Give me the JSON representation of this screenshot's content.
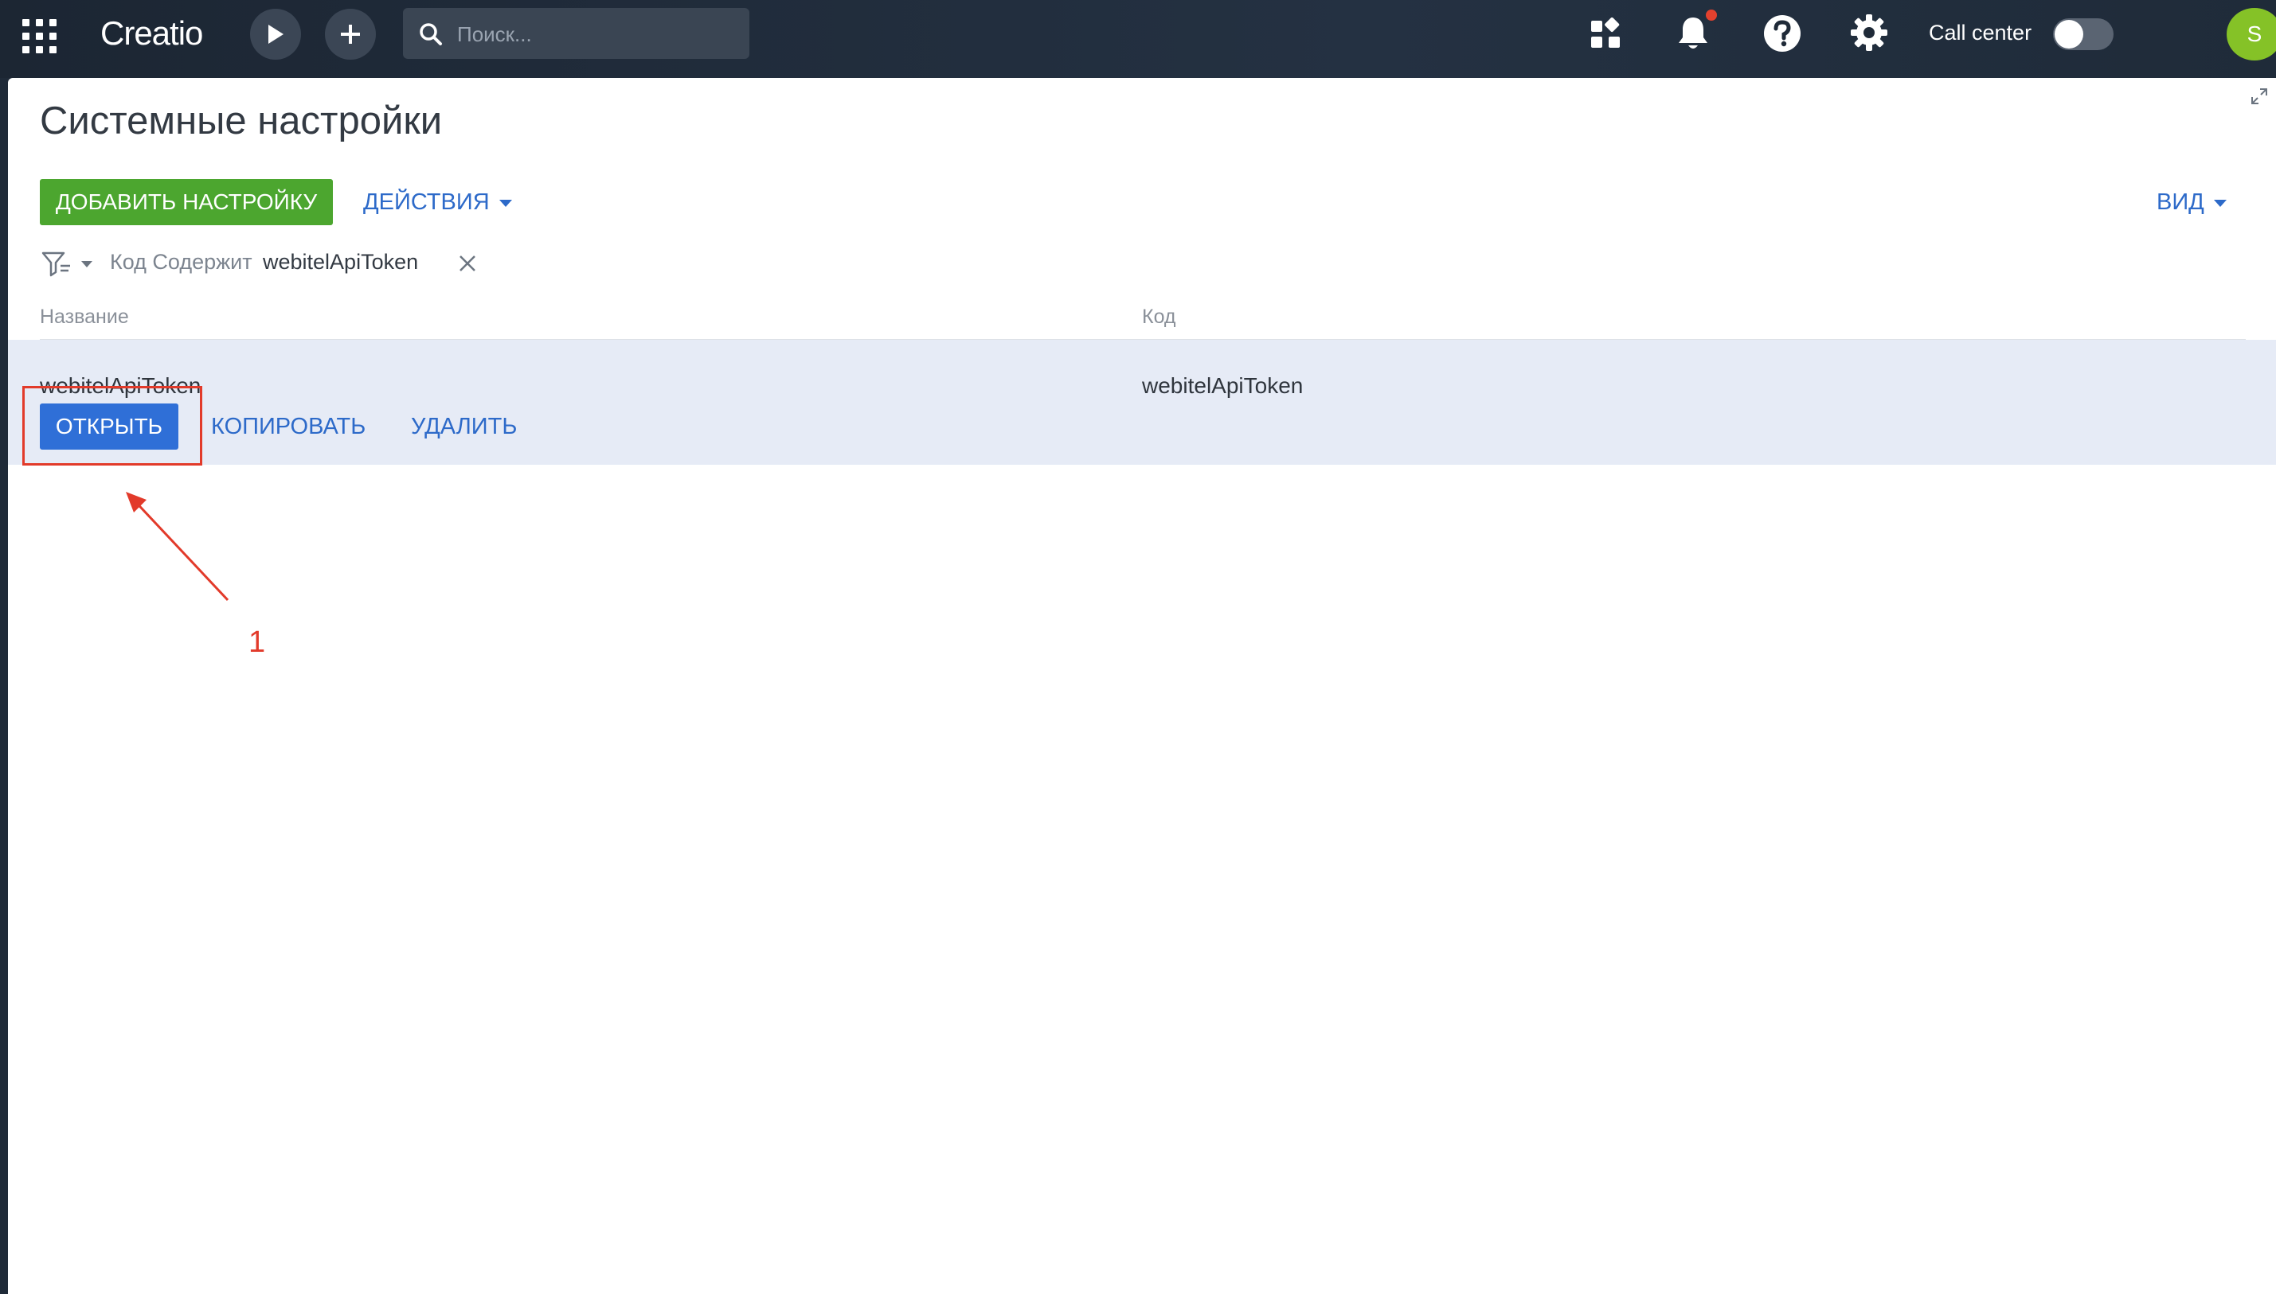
{
  "topbar": {
    "logo": "Creatio",
    "search_placeholder": "Поиск...",
    "call_center_label": "Call center",
    "avatar_initial": "S"
  },
  "page": {
    "title": "Системные настройки",
    "add_button": "ДОБАВИТЬ НАСТРОЙКУ",
    "actions_button": "ДЕЙСТВИЯ",
    "view_button": "ВИД"
  },
  "filter": {
    "field": "Код Содержит",
    "value": "webitelApiToken"
  },
  "table": {
    "columns": [
      "Название",
      "Код"
    ],
    "rows": [
      {
        "name": "webitelApiToken",
        "code": "webitelApiToken"
      }
    ],
    "row_actions": {
      "open": "ОТКРЫТЬ",
      "copy": "КОПИРОВАТЬ",
      "delete": "УДАЛИТЬ"
    }
  },
  "annotation": {
    "step_number": "1",
    "color": "#e23a2a"
  },
  "colors": {
    "topbar_bg": "#1f2a38",
    "add_button": "#4ca62f",
    "open_button": "#2f6fd7",
    "link": "#2d6ac9",
    "selected_row": "#e6ebf6",
    "avatar": "#85c227"
  }
}
